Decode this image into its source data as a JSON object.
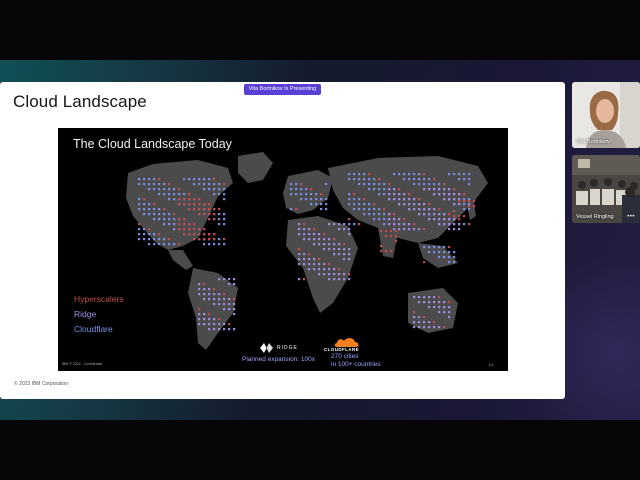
{
  "presenting_badge": "Vita Bortnikov Is Presenting",
  "slide": {
    "title": "Cloud Landscape",
    "footer": "© 2023 IBM Corporation",
    "map": {
      "title": "The Cloud Landscape Today",
      "legend": [
        {
          "label": "Hyperscalers",
          "color": "#c44b4f"
        },
        {
          "label": "Ridge",
          "color": "#a692e6"
        },
        {
          "label": "Cloudflare",
          "color": "#7a93ea"
        }
      ],
      "ridge": {
        "logo_text": "RIDGE",
        "caption": "Planned expansion: 100x"
      },
      "cloudflare": {
        "logo_text": "CLOUDFLARE",
        "caption_line1": "270 cities",
        "caption_line2": "in 100+ countries"
      },
      "ibm_footer": "IBM © 2022 - Confidential",
      "page_number": "14"
    }
  },
  "participants": [
    {
      "name": "Vita Bortnikov"
    },
    {
      "name": "Vessel Ringling",
      "more_icon": "more-options-icon"
    }
  ],
  "colors": {
    "accent": "#5a3fd6",
    "land": "#4a4a4a",
    "dot_blue": "#7a8fe8",
    "dot_purple": "#a58be0",
    "dot_red": "#c44b4f"
  }
}
